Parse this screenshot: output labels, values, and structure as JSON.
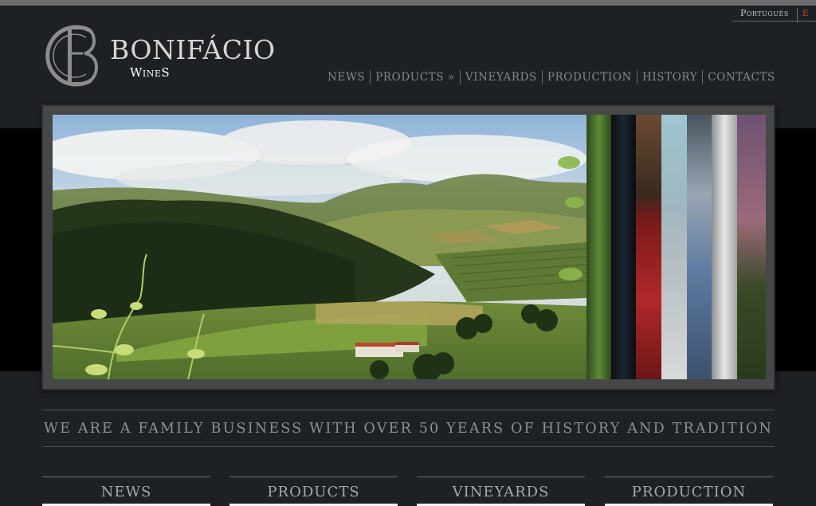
{
  "header": {
    "languages": [
      {
        "label": "Português"
      },
      {
        "label": "E"
      }
    ],
    "brand": {
      "name": "BONIFÁCIO",
      "sub": "WineS",
      "monogram": "CB"
    },
    "nav": [
      {
        "label": "NEWS"
      },
      {
        "label": "PRODUCTS »"
      },
      {
        "label": "VINEYARDS"
      },
      {
        "label": "PRODUCTION"
      },
      {
        "label": "HISTORY"
      },
      {
        "label": "CONTACTS"
      }
    ]
  },
  "slider": {
    "main_image": "vineyard-landscape",
    "thumbnails": [
      "vine-leaves",
      "cellar-pipes",
      "red-tank",
      "steel-stairs",
      "steel-tank",
      "white-tank",
      "sunset-vineyard"
    ]
  },
  "tagline": "WE ARE A FAMILY BUSINESS WITH OVER 50 YEARS OF HISTORY AND TRADITION",
  "boxes": [
    {
      "title": "NEWS"
    },
    {
      "title": "PRODUCTS"
    },
    {
      "title": "VINEYARDS"
    },
    {
      "title": "PRODUCTION"
    }
  ],
  "colors": {
    "background": "#1e2123",
    "band": "#000000",
    "accent_red": "#c43b2b",
    "nav_text": "#858789"
  }
}
